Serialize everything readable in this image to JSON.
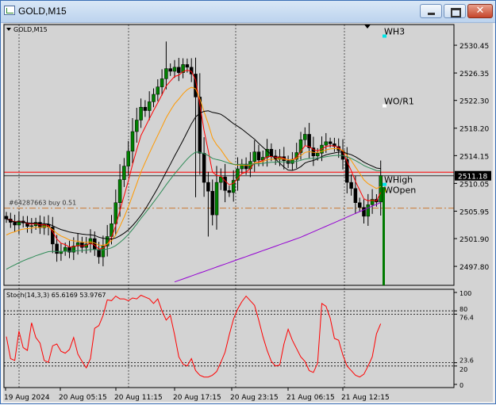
{
  "window": {
    "title": "GOLD,M15",
    "close_glyph": "✕"
  },
  "chart_data": {
    "type": "candlestick",
    "symbol_label": "GOLD,M15",
    "price_axis": {
      "range": [
        2495.0,
        2533.5
      ],
      "ticks": [
        "2530.45",
        "2526.35",
        "2522.30",
        "2518.20",
        "2514.15",
        "2510.05",
        "2505.95",
        "2501.90",
        "2497.80"
      ]
    },
    "current_price": "2511.18",
    "order_label": "#64287663 buy 0.51",
    "order_price": 2506.4,
    "levels": [
      {
        "label": "WH3",
        "price": 2531.8,
        "color": "#00e5e5"
      },
      {
        "label": "WO/R1",
        "price": 2521.5,
        "color": "#ffffff"
      },
      {
        "label": "WHigh",
        "price": 2509.9,
        "color": "#00e5e5"
      },
      {
        "label": "WOpen",
        "price": 2509.0,
        "color": "#ffff00"
      }
    ],
    "time_labels": [
      "19 Aug 2024",
      "20 Aug 05:15",
      "20 Aug 11:15",
      "20 Aug 17:15",
      "20 Aug 23:15",
      "21 Aug 06:15",
      "21 Aug 12:15"
    ],
    "closes": [
      2504.8,
      2504.3,
      2503.9,
      2504.5,
      2504.2,
      2503.7,
      2503.8,
      2504.3,
      2503.5,
      2504.0,
      2503.6,
      2501.1,
      2499.7,
      2500.0,
      2500.6,
      2499.9,
      2500.8,
      2501.3,
      2500.6,
      2501.1,
      2501.9,
      2500.3,
      2499.2,
      2500.8,
      2502.2,
      2504.1,
      2507.2,
      2510.6,
      2512.6,
      2514.8,
      2517.7,
      2519.4,
      2521.3,
      2520.8,
      2522.1,
      2523.2,
      2524.3,
      2525.5,
      2527.0,
      2526.6,
      2527.2,
      2526.4,
      2527.6,
      2527.2,
      2526.2,
      2522.8,
      2514.5,
      2510.2,
      2508.9,
      2505.4,
      2510.2,
      2511.0,
      2509.0,
      2508.7,
      2510.5,
      2512.2,
      2512.9,
      2512.2,
      2513.3,
      2514.7,
      2513.5,
      2513.9,
      2515.1,
      2514.1,
      2513.6,
      2514.0,
      2513.4,
      2513.0,
      2513.6,
      2514.6,
      2516.5,
      2517.3,
      2515.3,
      2514.1,
      2514.5,
      2515.7,
      2516.2,
      2515.9,
      2515.5,
      2514.9,
      2513.6,
      2510.2,
      2509.3,
      2507.2,
      2506.5,
      2505.2,
      2506.9,
      2507.7,
      2507.3,
      2511.2
    ],
    "ma_series": [
      {
        "name": "MA red",
        "color": "#ff0000"
      },
      {
        "name": "MA orange",
        "color": "#ff9900"
      },
      {
        "name": "MA black",
        "color": "#000000"
      },
      {
        "name": "MA green",
        "color": "#2e8b57"
      },
      {
        "name": "MA purple",
        "color": "#9400d3"
      }
    ],
    "stoch": {
      "label": "Stoch(14,3,3) 65.6169 53.9767",
      "ticks": [
        "100",
        "80",
        "76.4",
        "23.6",
        "20",
        "0"
      ],
      "values": [
        52,
        28,
        26,
        58,
        40,
        37,
        67,
        51,
        45,
        26,
        24,
        42,
        44,
        36,
        34,
        38,
        51,
        33,
        25,
        18,
        28,
        61,
        64,
        75,
        92,
        91,
        96,
        93,
        93,
        91,
        94,
        93,
        97,
        95,
        93,
        88,
        93,
        80,
        70,
        75,
        54,
        30,
        22,
        20,
        28,
        15,
        10,
        8,
        8,
        10,
        14,
        24,
        35,
        54,
        71,
        82,
        90,
        96,
        91,
        86,
        70,
        52,
        37,
        25,
        20,
        21,
        44,
        60,
        48,
        39,
        30,
        25,
        15,
        13,
        23,
        88,
        85,
        72,
        50,
        48,
        32,
        20,
        15,
        10,
        8,
        11,
        20,
        30,
        55,
        66
      ]
    }
  }
}
